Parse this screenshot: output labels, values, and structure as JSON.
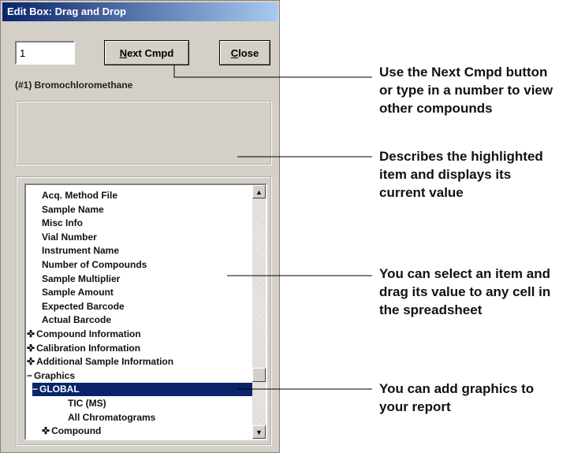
{
  "dialog": {
    "title": "Edit Box: Drag and Drop",
    "compound_number_value": "1",
    "next_button": {
      "mnemonic": "N",
      "rest": "ext Cmpd"
    },
    "close_button": {
      "mnemonic": "C",
      "rest": "lose"
    },
    "compound_label": "(#1)  Bromochloromethane",
    "description_text": ""
  },
  "tree": {
    "items": [
      {
        "label": "Acq. Method File",
        "prefix": ""
      },
      {
        "label": "Sample Name",
        "prefix": ""
      },
      {
        "label": "Misc Info",
        "prefix": ""
      },
      {
        "label": "Vial Number",
        "prefix": ""
      },
      {
        "label": "Instrument Name",
        "prefix": ""
      },
      {
        "label": "Number of Compounds",
        "prefix": ""
      },
      {
        "label": "Sample Multiplier",
        "prefix": ""
      },
      {
        "label": "Sample Amount",
        "prefix": ""
      },
      {
        "label": "Expected Barcode",
        "prefix": ""
      },
      {
        "label": "Actual Barcode",
        "prefix": ""
      },
      {
        "label": "Compound Information",
        "prefix": "✜"
      },
      {
        "label": "Calibration Information",
        "prefix": "✜"
      },
      {
        "label": "Additional Sample Information",
        "prefix": "✜"
      },
      {
        "label": "Graphics",
        "prefix": "−"
      },
      {
        "label": "GLOBAL",
        "prefix": "−",
        "selected": true
      },
      {
        "label": "TIC (MS)",
        "prefix": ""
      },
      {
        "label": "All Chromatograms",
        "prefix": ""
      },
      {
        "label": "Compound",
        "prefix": "✜"
      }
    ]
  },
  "callouts": [
    {
      "lines": [
        "Use the Next Cmpd button",
        "or type in a number to view",
        "other compounds"
      ]
    },
    {
      "lines": [
        "Describes the highlighted",
        "item and displays its",
        "current value"
      ]
    },
    {
      "lines": [
        "You can select an item and",
        "drag its value to any cell in",
        "the spreadsheet"
      ]
    },
    {
      "lines": [
        "You can add graphics to",
        "your report"
      ]
    }
  ],
  "icons": {
    "scroll_up": "up-arrow-icon",
    "scroll_down": "down-arrow-icon",
    "expand": "plus-icon",
    "collapse": "minus-icon"
  },
  "colors": {
    "title_start": "#0a246a",
    "title_end": "#a6caf0",
    "selection": "#0a246a",
    "dialog_bg": "#d4d0c8"
  }
}
